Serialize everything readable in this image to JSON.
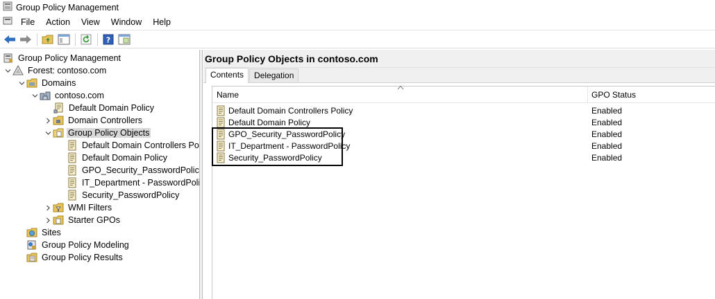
{
  "window": {
    "title": "Group Policy Management"
  },
  "menu": [
    "File",
    "Action",
    "View",
    "Window",
    "Help"
  ],
  "toolbar": {
    "buttons": [
      "back-icon",
      "forward-icon",
      "up-folder-icon",
      "show-hide-tree-icon",
      "refresh-icon",
      "help-icon",
      "properties-icon"
    ]
  },
  "tree": {
    "root": "Group Policy Management",
    "forest": "Forest: contoso.com",
    "domains": "Domains",
    "domain": "contoso.com",
    "default_domain_policy": "Default Domain Policy",
    "domain_controllers": "Domain Controllers",
    "gpo_folder": "Group Policy Objects",
    "gpo_children": [
      "Default Domain Controllers Pol",
      "Default Domain Policy",
      "GPO_Security_PasswordPolicy",
      "IT_Department - PasswordPolicy",
      "Security_PasswordPolicy"
    ],
    "wmi_filters": "WMI Filters",
    "starter_gpos": "Starter GPOs",
    "sites": "Sites",
    "modeling": "Group Policy Modeling",
    "results": "Group Policy Results"
  },
  "right_pane": {
    "title": "Group Policy Objects in contoso.com",
    "tabs": [
      "Contents",
      "Delegation"
    ],
    "columns": {
      "name": "Name",
      "status": "GPO Status"
    },
    "rows": [
      {
        "name": "Default Domain Controllers Policy",
        "status": "Enabled"
      },
      {
        "name": "Default Domain Policy",
        "status": "Enabled"
      },
      {
        "name": "GPO_Security_PasswordPolicy",
        "status": "Enabled"
      },
      {
        "name": "IT_Department - PasswordPolicy",
        "status": "Enabled"
      },
      {
        "name": "Security_PasswordPolicy",
        "status": "Enabled"
      }
    ]
  }
}
